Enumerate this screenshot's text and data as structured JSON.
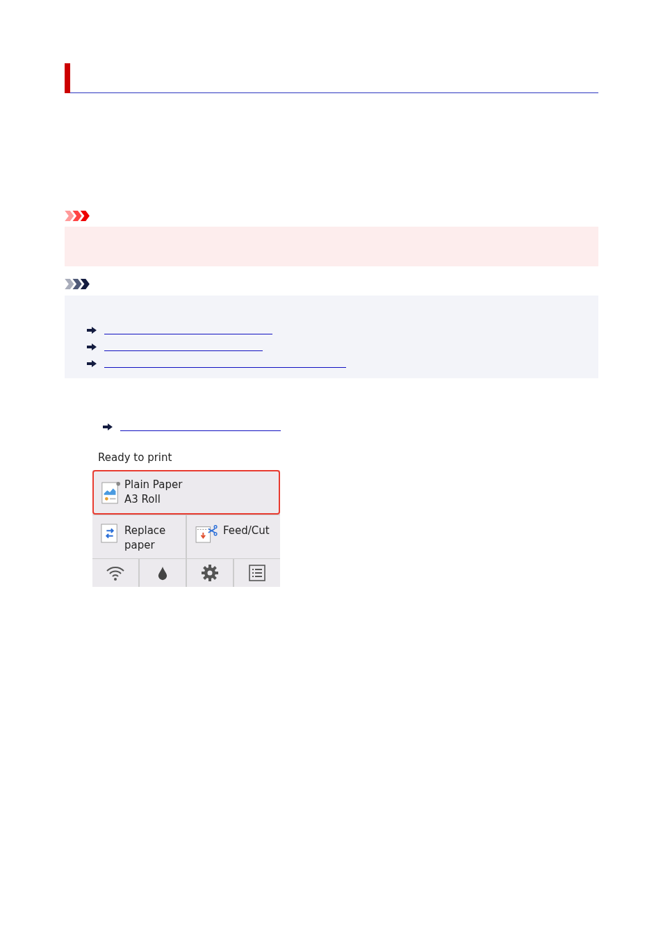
{
  "panel": {
    "status": "Ready to print",
    "media": {
      "lines": [
        "Plain Paper",
        "A3 Roll"
      ],
      "selected": true
    },
    "buttons": [
      {
        "kind": "replace",
        "label": "Replace paper"
      },
      {
        "kind": "feed",
        "label": "Feed/Cut"
      }
    ],
    "icons": [
      {
        "kind": "wifi"
      },
      {
        "kind": "ink"
      },
      {
        "kind": "settings"
      },
      {
        "kind": "list"
      }
    ]
  }
}
